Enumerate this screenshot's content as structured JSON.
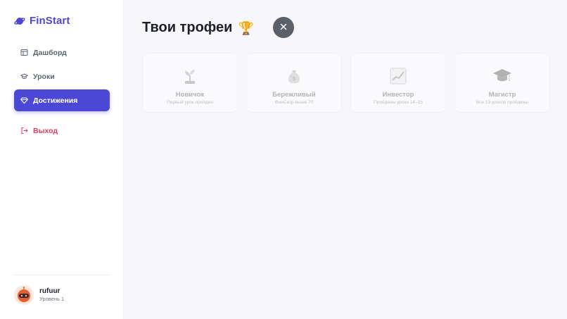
{
  "brand": {
    "name": "FinStart"
  },
  "nav": [
    {
      "label": "Дашборд",
      "icon": "dashboard-icon"
    },
    {
      "label": "Уроки",
      "icon": "graduation-cap-icon"
    },
    {
      "label": "Достижения",
      "icon": "diamond-icon",
      "active": true
    },
    {
      "label": "Выход",
      "icon": "logout-icon"
    }
  ],
  "user": {
    "name": "rufuur",
    "level": "Уровень 1"
  },
  "page": {
    "title": "Твои трофеи",
    "title_icon": "trophy-icon"
  },
  "achievements": [
    {
      "title": "Новичок",
      "description": "Первый урок пройден",
      "icon": "sprout-icon"
    },
    {
      "title": "Бережливый",
      "description": "ФинСкор выше 70",
      "icon": "money-bag-icon"
    },
    {
      "title": "Инвестор",
      "description": "Пройдены уроки 14–15",
      "icon": "chart-up-icon"
    },
    {
      "title": "Магистр",
      "description": "Все 19 уроков пройдены",
      "icon": "graduation-cap-icon"
    }
  ],
  "colors": {
    "accent": "#4b48d6",
    "logout": "#e23d5b",
    "background": "#f7f7fb"
  }
}
